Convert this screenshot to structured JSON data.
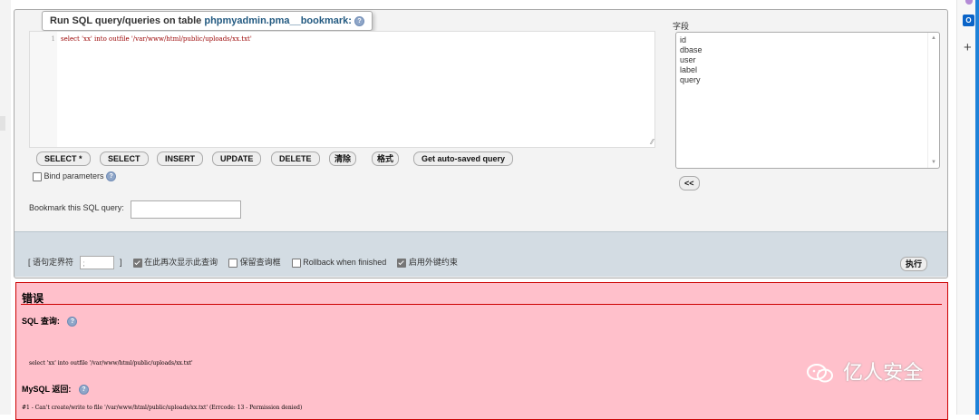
{
  "legend": {
    "prefix": "Run SQL query/queries on table",
    "table": "phpmyadmin.pma__bookmark:"
  },
  "editor": {
    "line_number": "1",
    "code": "select 'xx' into outfile '/var/www/html/public/uploads/xx.txt'"
  },
  "fields": {
    "label": "字段",
    "items": [
      "id",
      "dbase",
      "user",
      "label",
      "query"
    ],
    "insert_button": "<<"
  },
  "buttons": {
    "select_star": "SELECT *",
    "select": "SELECT",
    "insert": "INSERT",
    "update": "UPDATE",
    "delete": "DELETE",
    "clear": "清除",
    "format": "格式",
    "autosaved": "Get auto-saved query"
  },
  "bind_params": {
    "label": "Bind parameters",
    "checked": false
  },
  "bookmark": {
    "label": "Bookmark this SQL query:",
    "value": ""
  },
  "options": {
    "delimiter_open": "[ 语句定界符",
    "delimiter_value": ";",
    "delimiter_close": "]",
    "show_again": "在此再次显示此查询",
    "keep_box": "保留查询框",
    "rollback": "Rollback when finished",
    "foreign_keys": "启用外键约束",
    "go_button": "执行"
  },
  "error": {
    "title": "错误",
    "sql_label": "SQL 查询:",
    "sql_text": "select 'xx' into outfile '/var/www/html/public/uploads/xx.txt'",
    "mysql_label": "MySQL 返回:",
    "mysql_text": "#1 - Can't create/write to file '/var/www/html/public/uploads/xx.txt' (Errcode: 13 - Permission denied)"
  },
  "watermark": {
    "text": "亿人安全"
  },
  "colors": {
    "panel_bg": "#f3f3f3",
    "options_bg": "#d3dce3",
    "error_bg": "#ffc0cb",
    "error_border": "#cc0000",
    "link": "#235a81"
  }
}
